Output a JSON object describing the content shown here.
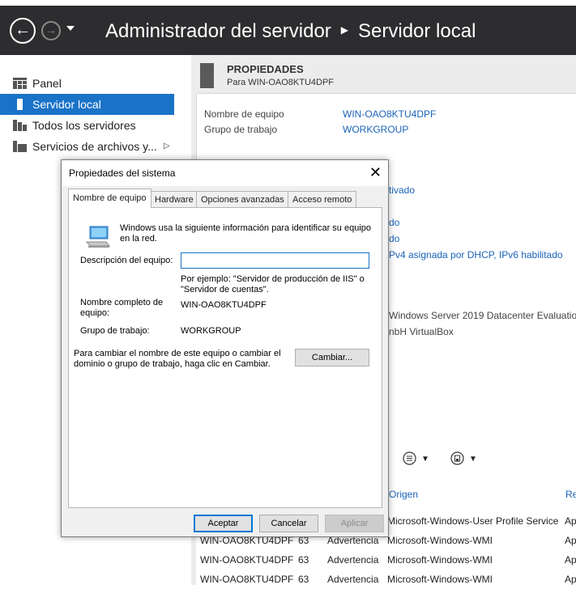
{
  "window": {
    "breadcrumb_root": "Administrador del servidor",
    "breadcrumb_current": "Servidor local"
  },
  "sidebar": {
    "items": [
      {
        "label": "Panel",
        "icon": "dashboard-icon"
      },
      {
        "label": "Servidor local",
        "icon": "local-server-icon",
        "active": true
      },
      {
        "label": "Todos los servidores",
        "icon": "all-servers-icon"
      },
      {
        "label": "Servicios de archivos y...",
        "icon": "file-services-icon",
        "expandable": true
      }
    ]
  },
  "properties": {
    "title": "PROPIEDADES",
    "subtitle": "Para WIN-OAO8KTU4DPF",
    "computer_name_label": "Nombre de equipo",
    "computer_name_value": "WIN-OAO8KTU4DPF",
    "workgroup_label": "Grupo de trabajo",
    "workgroup_value": "WORKGROUP",
    "partial_values": [
      "tivado",
      "do",
      "do",
      "Pv4 asignada por DHCP, IPv6 habilitado",
      "Windows Server 2019 Datacenter Evaluation",
      "nbH VirtualBox"
    ]
  },
  "events": {
    "header_origin": "Origen",
    "header_re": "Re",
    "rows": [
      {
        "server": "",
        "id": "",
        "level": "",
        "origin": "Microsoft-Windows-User Profile Service",
        "re": "Ap"
      },
      {
        "server": "WIN-OAO8KTU4DPF",
        "id": "63",
        "level": "Advertencia",
        "origin": "Microsoft-Windows-WMI",
        "re": "Ap"
      },
      {
        "server": "WIN-OAO8KTU4DPF",
        "id": "63",
        "level": "Advertencia",
        "origin": "Microsoft-Windows-WMI",
        "re": "Ap"
      },
      {
        "server": "WIN-OAO8KTU4DPF",
        "id": "63",
        "level": "Advertencia",
        "origin": "Microsoft-Windows-WMI",
        "re": "Ap"
      }
    ]
  },
  "dialog": {
    "title": "Propiedades del sistema",
    "tabs": [
      "Nombre de equipo",
      "Hardware",
      "Opciones avanzadas",
      "Acceso remoto"
    ],
    "intro": "Windows usa la siguiente información para identificar su equipo en la red.",
    "description_label": "Descripción del equipo:",
    "description_value": "",
    "example_text": "Por ejemplo: \"Servidor de producción de IIS\" o \"Servidor de cuentas\".",
    "full_name_label": "Nombre completo de equipo:",
    "full_name_value": "WIN-OAO8KTU4DPF",
    "workgroup_label": "Grupo de trabajo:",
    "workgroup_value": "WORKGROUP",
    "change_text": "Para cambiar el nombre de este equipo o cambiar el dominio o grupo de trabajo, haga clic en Cambiar.",
    "change_button": "Cambiar...",
    "ok_button": "Aceptar",
    "cancel_button": "Cancelar",
    "apply_button": "Aplicar"
  }
}
